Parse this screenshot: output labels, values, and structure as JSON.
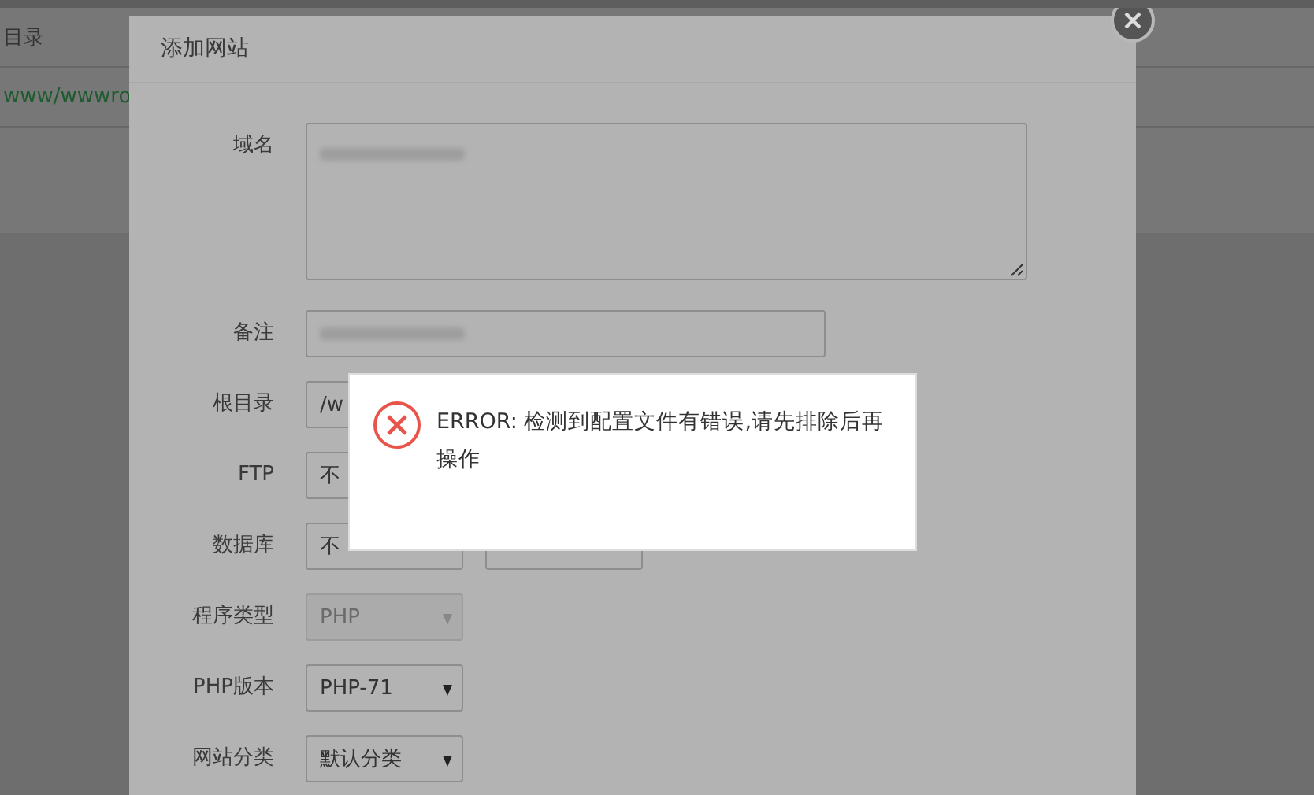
{
  "background": {
    "column_header": "目录",
    "path_link": "www/wwwro"
  },
  "modal": {
    "title": "添加网站",
    "fields": [
      {
        "label": "域名",
        "kind": "textarea",
        "redacted": true
      },
      {
        "label": "备注",
        "kind": "input",
        "redacted": true
      },
      {
        "label": "根目录",
        "kind": "input",
        "value": "/w"
      },
      {
        "label": "FTP",
        "kind": "select",
        "value": "不"
      },
      {
        "label": "数据库",
        "kind": "select-pair",
        "value": "不"
      },
      {
        "label": "程序类型",
        "kind": "select",
        "value": "PHP",
        "disabled": true
      },
      {
        "label": "PHP版本",
        "kind": "select",
        "value": "PHP-71",
        "disabled": false
      },
      {
        "label": "网站分类",
        "kind": "select",
        "value": "默认分类",
        "disabled": false
      }
    ]
  },
  "error": {
    "message": "ERROR: 检测到配置文件有错误,请先排除后再操作"
  }
}
